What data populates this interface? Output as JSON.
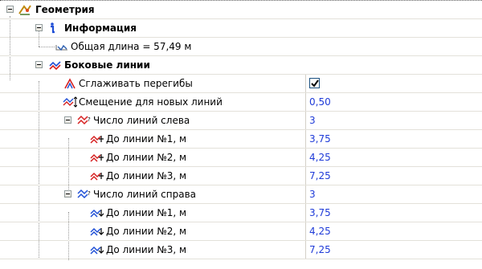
{
  "categories": {
    "geometry": "Геометрия",
    "info": "Информация",
    "lanes": "Боковые линии"
  },
  "properties": {
    "total_length": "Общая длина = 57,49 м",
    "smooth_bends": {
      "label": "Сглаживать перегибы",
      "checked": true
    },
    "offset_new": {
      "label": "Смещение для новых линий",
      "value": "0,50"
    },
    "left_count": {
      "label": "Число линий слева",
      "value": "3"
    },
    "left_items": [
      {
        "label": "До линии №1, м",
        "value": "3,75"
      },
      {
        "label": "До линии №2, м",
        "value": "4,25"
      },
      {
        "label": "До линии №3, м",
        "value": "7,25"
      }
    ],
    "right_count": {
      "label": "Число линий справа",
      "value": "3"
    },
    "right_items": [
      {
        "label": "До линии №1, м",
        "value": "3,75"
      },
      {
        "label": "До линии №2, м",
        "value": "4,25"
      },
      {
        "label": "До линии №3, м",
        "value": "7,25"
      }
    ]
  },
  "colors": {
    "value_text": "#1f3bd8",
    "grid_line": "#e3e1da"
  }
}
